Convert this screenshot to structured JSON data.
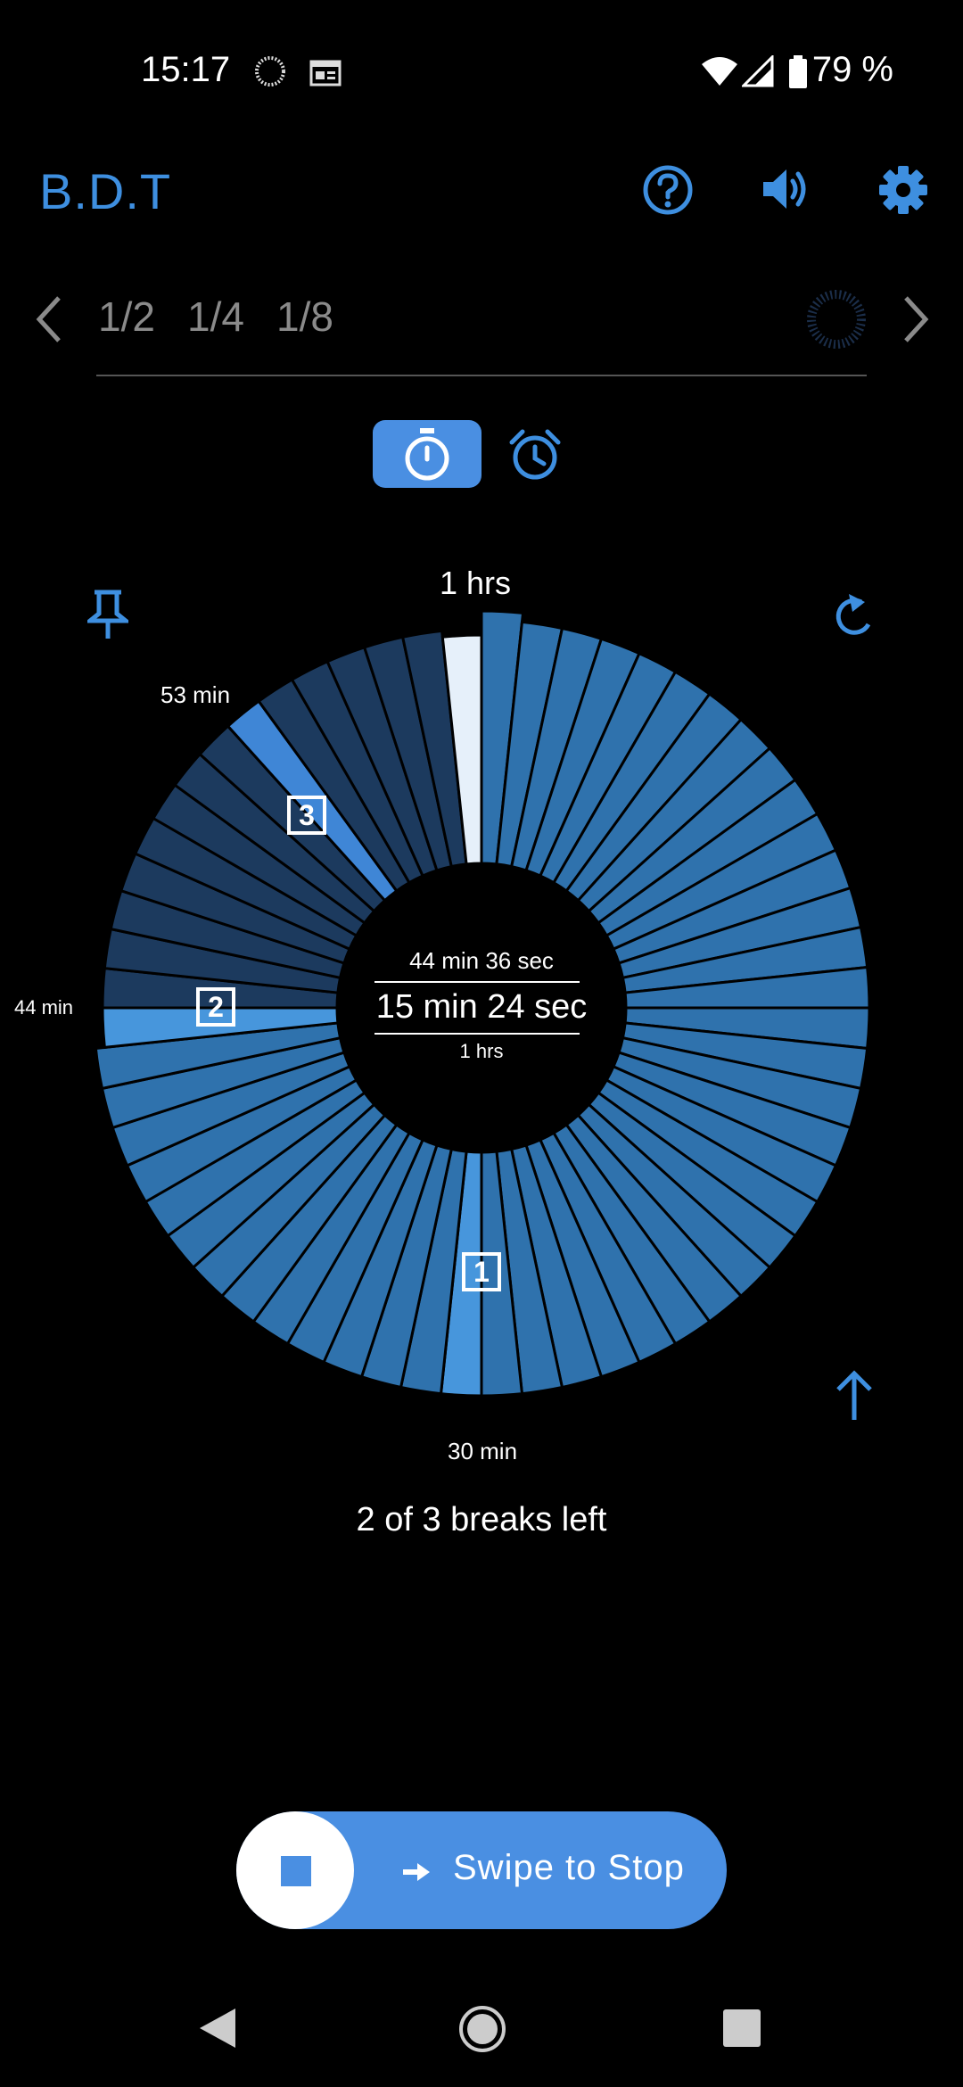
{
  "status_bar": {
    "time": "15:17",
    "battery": "79 %"
  },
  "header": {
    "title": "B.D.T"
  },
  "ratio_tabs": [
    "1/2",
    "1/4",
    "1/8"
  ],
  "dial": {
    "top_label": "1 hrs",
    "bottom_label": "30 min",
    "left_label": "44 min",
    "upper_left_label": "53 min",
    "center": {
      "elapsed": "44 min 36 sec",
      "remaining": "15 min 24 sec",
      "total": "1 hrs"
    },
    "markers": [
      "1",
      "2",
      "3"
    ],
    "colors": {
      "done": "#2f72ad",
      "remaining": "#1c3a5e",
      "current": "#e6f0fa",
      "break": "#4796dc",
      "break_next": "#3f86d6"
    }
  },
  "breaks_status": "2 of 3 breaks left",
  "swipe": {
    "label": "Swipe to Stop"
  },
  "colors": {
    "accent": "#4a8fe2",
    "background": "#000000"
  }
}
